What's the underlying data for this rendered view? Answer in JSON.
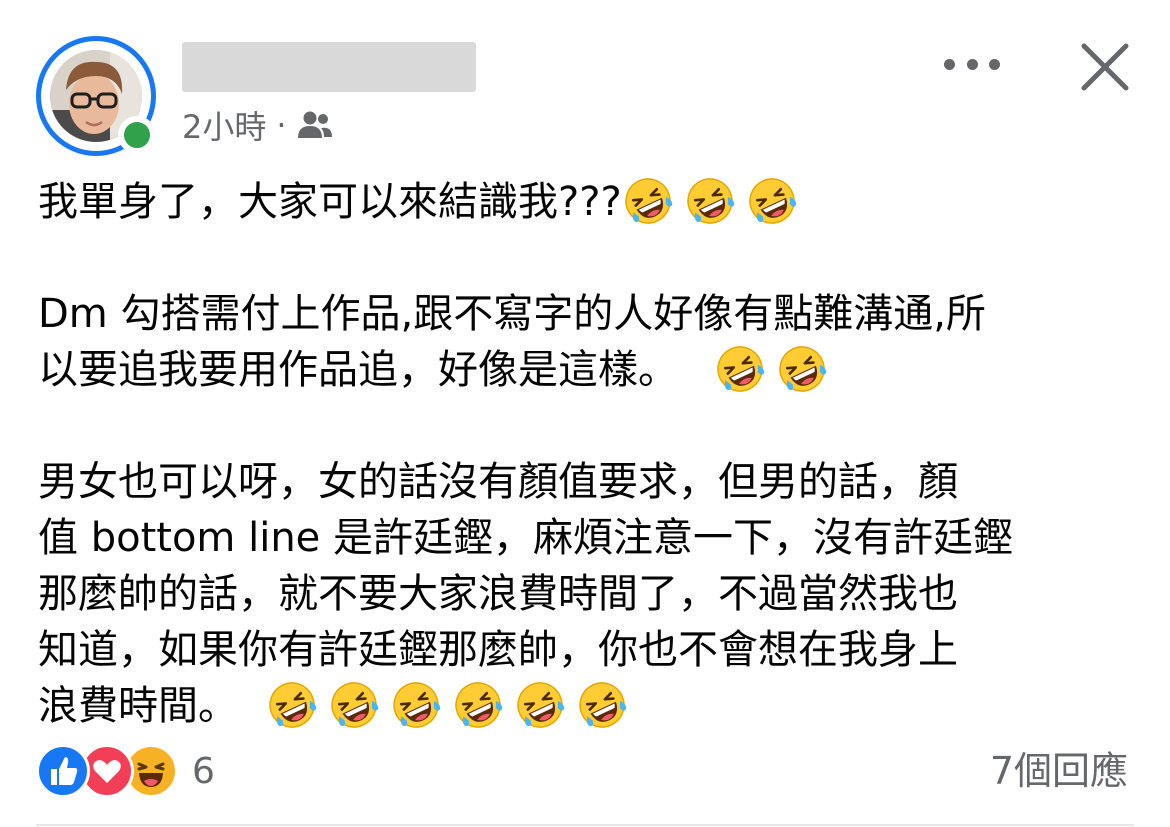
{
  "post": {
    "timestamp": "2小時",
    "separator": "·",
    "audience_icon": "friends-icon",
    "more_icon": "more-icon",
    "close_icon": "close-icon",
    "author_online": true,
    "body": {
      "p1": {
        "line1": "我單身了，大家可以來結識我???"
      },
      "p2": {
        "line1": "Dm 勾搭需付上作品,跟不寫字的人好像有點難溝通,所",
        "line2": "以要追我要用作品追，好像是這樣。"
      },
      "p3": {
        "line1": "男女也可以呀，女的話沒有顏值要求，但男的話，顏",
        "line2": "值 bottom line 是許廷鏗，麻煩注意一下，沒有許廷鏗",
        "line3": "那麼帥的話，就不要大家浪費時間了，不過當然我也",
        "line4": "知道，如果你有許廷鏗那麼帥，你也不會想在我身上",
        "line5": "浪費時間。"
      }
    },
    "emoji_name": "rolling-on-floor-laughing-emoji",
    "footer": {
      "reaction_icons": [
        "like-reaction-icon",
        "love-reaction-icon",
        "haha-reaction-icon"
      ],
      "reaction_count": "6",
      "comment_count": "7個回應"
    },
    "colors": {
      "accent": "#1877f2",
      "online": "#31a24c",
      "love": "#f33e58",
      "haha": "#f7b125",
      "secondary_text": "#65676b"
    }
  }
}
